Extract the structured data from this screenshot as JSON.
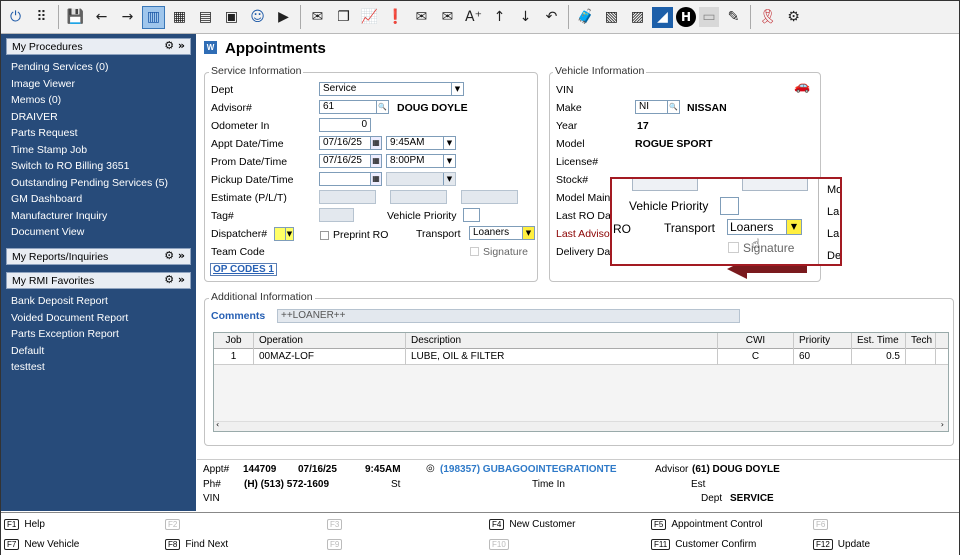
{
  "toolbar": {
    "icons": [
      "power-icon",
      "apps-grid-icon",
      "save-icon",
      "back-arrow-icon",
      "forward-arrow-icon",
      "panel-icon",
      "calculator-icon",
      "calendar-icon",
      "disk-icon",
      "user-icon",
      "play-icon",
      "mail-icon",
      "copy-icon",
      "chart-icon",
      "message-icon",
      "inbox-icon",
      "envelope-open-icon",
      "font-size-icon",
      "up-arrow-icon",
      "down-arrow-icon",
      "undo-icon",
      "briefcase-icon",
      "cube-icon",
      "image-icon",
      "app-icon",
      "h-logo-icon",
      "disabled-icon",
      "paint-icon",
      "ribbon-icon",
      "gear-icon"
    ],
    "glyphs": [
      "⏻",
      "⠿",
      "💾",
      "←",
      "→",
      "▥",
      "▦",
      "▤",
      "▣",
      "☺",
      "▶",
      "✉",
      "❐",
      "📈",
      "❗",
      "✉",
      "✉",
      "A⁺",
      "↑",
      "↓",
      "↶",
      "🧳",
      "▧",
      "▨",
      "◢",
      "H",
      "▭",
      "✎",
      "🎗",
      "⚙"
    ]
  },
  "sidebar": {
    "procedures": {
      "title": "My Procedures",
      "icons": "⚙ »",
      "items": [
        "Pending Services (0)",
        "Image Viewer",
        "Memos (0)",
        "DRAIVER",
        "Parts Request",
        "Time Stamp Job",
        "Switch to RO Billing 3651",
        "Outstanding Pending Services (5)",
        "GM Dashboard",
        "Manufacturer Inquiry",
        "Document View"
      ]
    },
    "reports": {
      "title": "My Reports/Inquiries",
      "icons": "⚙ »"
    },
    "favorites": {
      "title": "My RMI Favorites",
      "icons": "⚙ »",
      "items": [
        "Bank Deposit Report",
        "Voided Document Report",
        "Parts Exception Report",
        "Default",
        "testtest"
      ]
    }
  },
  "page": {
    "title_icon": "W",
    "title": "Appointments"
  },
  "service": {
    "legend": "Service Information",
    "dept_label": "Dept",
    "dept_value": "Service",
    "advisor_label": "Advisor#",
    "advisor_value": "61",
    "advisor_name": "DOUG DOYLE",
    "odometer_label": "Odometer In",
    "odometer_value": "0",
    "appt_label": "Appt Date/Time",
    "appt_date": "07/16/25",
    "appt_time": "9:45AM",
    "prom_label": "Prom Date/Time",
    "prom_date": "07/16/25",
    "prom_time": "8:00PM",
    "pickup_label": "Pickup Date/Time",
    "estimate_label": "Estimate (P/L/T)",
    "tag_label": "Tag#",
    "vehicle_priority_label": "Vehicle Priority",
    "dispatcher_label": "Dispatcher#",
    "preprint_label": "Preprint RO",
    "transport_label": "Transport",
    "transport_value": "Loaners",
    "team_code_label": "Team Code",
    "signature_label": "Signature",
    "op_codes_label": "OP CODES 1"
  },
  "vehicle": {
    "legend": "Vehicle Information",
    "vin_label": "VIN",
    "make_label": "Make",
    "make_code": "NI",
    "make_name": "NISSAN",
    "year_label": "Year",
    "year_value": "17",
    "model_label": "Model",
    "model_value": "ROGUE SPORT",
    "license_label": "License#",
    "stock_label": "Stock#",
    "model_main_label": "Model Main",
    "last_ro_label": "Last RO Dat",
    "last_advisor_label": "Last Advisor",
    "delivery_label": "Delivery Da"
  },
  "zoom": {
    "ro_fragment": "RO",
    "vehicle_priority": "Vehicle Priority",
    "transport": "Transport",
    "transport_value": "Loaners",
    "signature": "Signature",
    "right_labels": [
      "Mo",
      "La",
      "La",
      "De"
    ]
  },
  "additional": {
    "legend": "Additional Information",
    "comments_label": "Comments",
    "comments_value": "++LOANER++",
    "columns": [
      "Job",
      "Operation",
      "Description",
      "CWI",
      "Priority",
      "Est. Time",
      "Tech"
    ],
    "rows": [
      {
        "job": "1",
        "operation": "00MAZ-LOF",
        "description": "LUBE, OIL & FILTER",
        "cwi": "C",
        "priority": "60",
        "est_time": "0.5",
        "tech": ""
      }
    ]
  },
  "summary": {
    "appt_label": "Appt#",
    "appt_no": "144709",
    "date": "07/16/25",
    "time": "9:45AM",
    "customer": "(198357) GUBAGOOINTEGRATIONTE",
    "advisor_label": "Advisor",
    "advisor_value": "(61) DOUG DOYLE",
    "ph_label": "Ph#",
    "phone": "(H) (513) 572-1609",
    "st_label": "St",
    "time_in_label": "Time In",
    "est_label": "Est",
    "vin_label": "VIN",
    "dept_label": "Dept",
    "dept_value": "SERVICE"
  },
  "fkeys": [
    {
      "key": "F1",
      "label": "Help",
      "dim": false
    },
    {
      "key": "F2",
      "label": "",
      "dim": true
    },
    {
      "key": "F3",
      "label": "",
      "dim": true
    },
    {
      "key": "F4",
      "label": "New Customer",
      "dim": false
    },
    {
      "key": "F5",
      "label": "Appointment Control",
      "dim": false
    },
    {
      "key": "F6",
      "label": "",
      "dim": true
    },
    {
      "key": "F7",
      "label": "New Vehicle",
      "dim": false
    },
    {
      "key": "F8",
      "label": "Find Next",
      "dim": false
    },
    {
      "key": "F9",
      "label": "",
      "dim": true
    },
    {
      "key": "F10",
      "label": "",
      "dim": true
    },
    {
      "key": "F11",
      "label": "Customer Confirm",
      "dim": false
    },
    {
      "key": "F12",
      "label": "Update",
      "dim": false
    }
  ]
}
